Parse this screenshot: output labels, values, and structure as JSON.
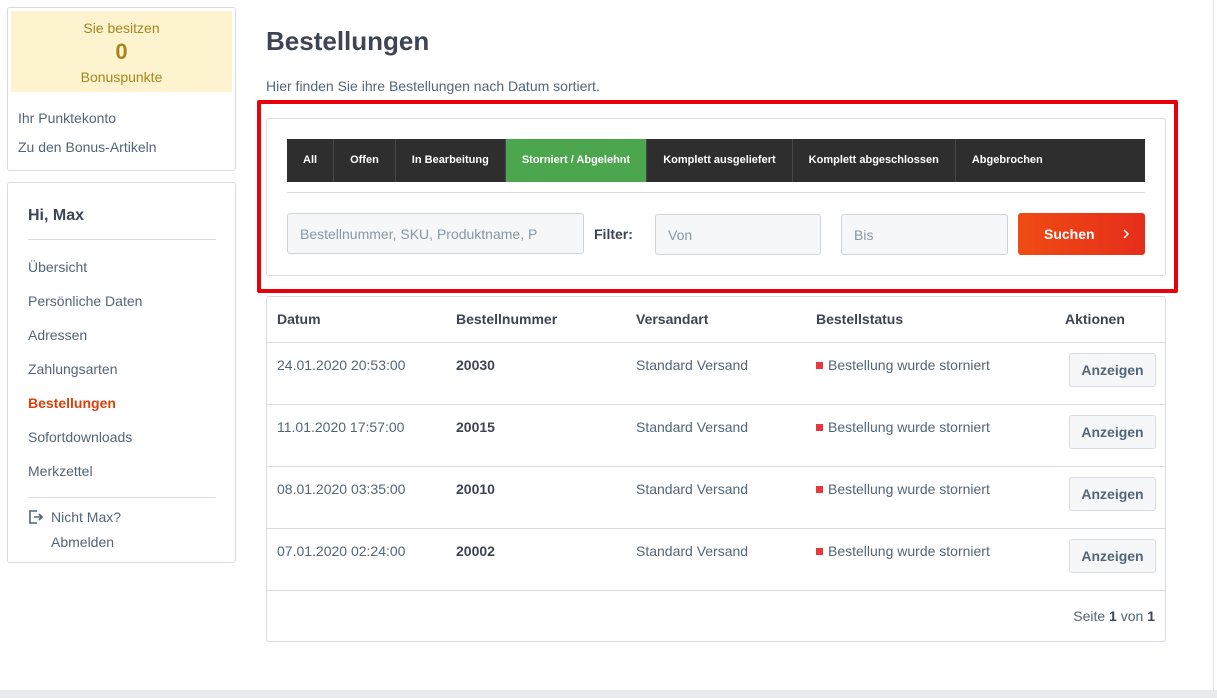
{
  "bonus": {
    "line1": "Sie besitzen",
    "points": "0",
    "line3": "Bonuspunkte",
    "links": [
      "Ihr Punktekonto",
      "Zu den Bonus-Artikeln"
    ],
    "color": "#a6861c",
    "background": "#fdf3ce"
  },
  "account": {
    "greeting": "Hi, Max",
    "nav": [
      {
        "label": "Übersicht",
        "active": false
      },
      {
        "label": "Persönliche Daten",
        "active": false
      },
      {
        "label": "Adressen",
        "active": false
      },
      {
        "label": "Zahlungsarten",
        "active": false
      },
      {
        "label": "Bestellungen",
        "active": true
      },
      {
        "label": "Sofortdownloads",
        "active": false
      },
      {
        "label": "Merkzettel",
        "active": false
      }
    ],
    "logout_line1": "Nicht Max?",
    "logout_line2": "Abmelden",
    "logout_icon": "logout-icon",
    "active_color": "#d9400b"
  },
  "main": {
    "title": "Bestellungen",
    "description": "Hier finden Sie ihre Bestellungen nach Datum sortiert."
  },
  "filter": {
    "tabs": [
      {
        "label": "All",
        "active": false
      },
      {
        "label": "Offen",
        "active": false
      },
      {
        "label": "In Bearbeitung",
        "active": false
      },
      {
        "label": "Storniert / Abgelehnt",
        "active": true
      },
      {
        "label": "Komplett ausgeliefert",
        "active": false
      },
      {
        "label": "Komplett abgeschlossen",
        "active": false
      },
      {
        "label": "Abgebrochen",
        "active": false
      }
    ],
    "search_placeholder": "Bestellnummer, SKU, Produktname, P",
    "filter_label": "Filter:",
    "from_placeholder": "Von",
    "to_placeholder": "Bis",
    "search_label": "Suchen",
    "active_tab_color": "#4ba64d",
    "tabbar_color": "#2e2e2e",
    "button_color": "#e62e1b",
    "highlight_color": "#e8000b"
  },
  "orders": {
    "headers": {
      "date": "Datum",
      "number": "Bestellnummer",
      "shipping": "Versandart",
      "status": "Bestellstatus",
      "actions": "Aktionen"
    },
    "rows": [
      {
        "date": "24.01.2020 20:53:00",
        "number": "20030",
        "shipping": "Standard Versand",
        "status": "Bestellung wurde storniert",
        "action": "Anzeigen"
      },
      {
        "date": "11.01.2020 17:57:00",
        "number": "20015",
        "shipping": "Standard Versand",
        "status": "Bestellung wurde storniert",
        "action": "Anzeigen"
      },
      {
        "date": "08.01.2020 03:35:00",
        "number": "20010",
        "shipping": "Standard Versand",
        "status": "Bestellung wurde storniert",
        "action": "Anzeigen"
      },
      {
        "date": "07.01.2020 02:24:00",
        "number": "20002",
        "shipping": "Standard Versand",
        "status": "Bestellung wurde storniert",
        "action": "Anzeigen"
      }
    ],
    "status_color": "#e8383d",
    "pagination": {
      "prefix": "Seite",
      "current": "1",
      "separator": "von",
      "total": "1"
    }
  }
}
